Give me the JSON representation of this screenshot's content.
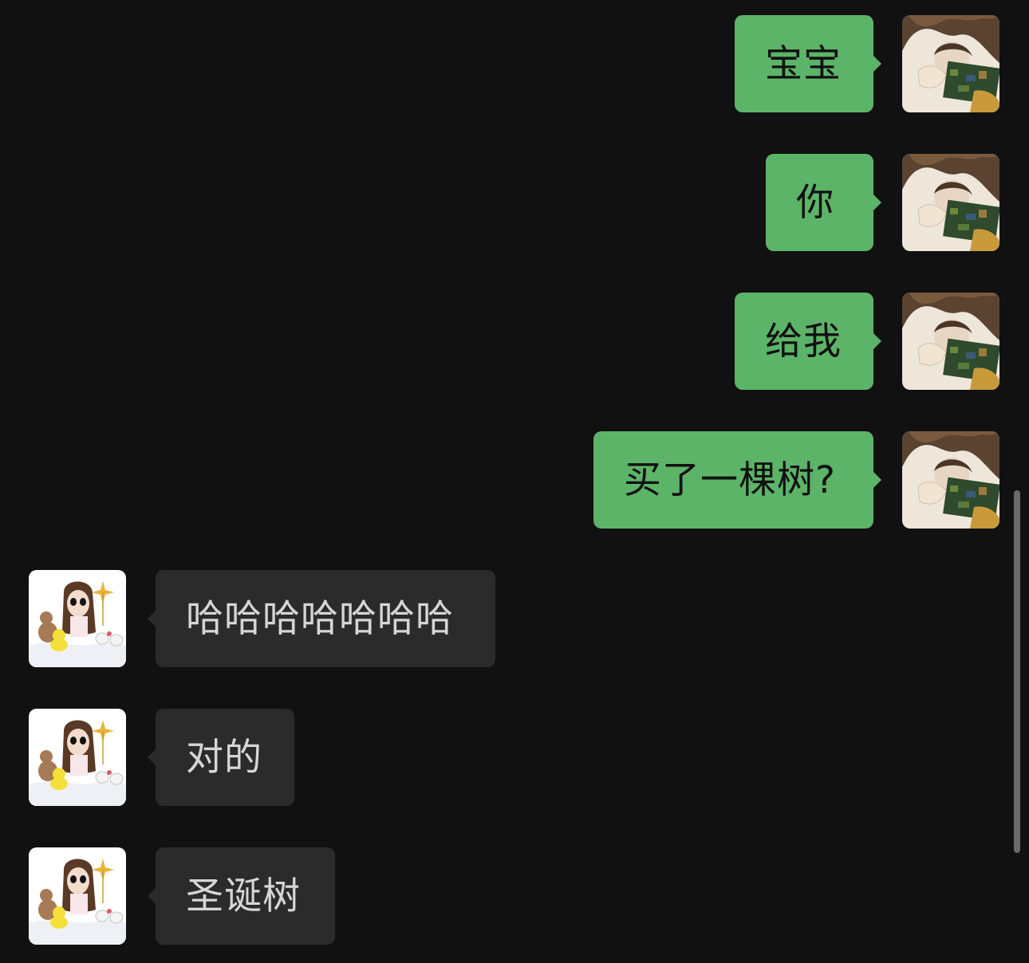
{
  "colors": {
    "background": "#111111",
    "sent_bubble": "#5cb468",
    "received_bubble": "#2b2b2b",
    "sent_text": "#111111",
    "received_text": "#d6d6d6",
    "scrollbar": "#6a6a6a"
  },
  "avatars": {
    "self": "avatar-self-illustration",
    "contact": "avatar-contact-illustration"
  },
  "messages": [
    {
      "side": "sent",
      "text": "宝宝"
    },
    {
      "side": "sent",
      "text": "你"
    },
    {
      "side": "sent",
      "text": "给我"
    },
    {
      "side": "sent",
      "text": "买了一棵树?"
    },
    {
      "side": "received",
      "text": "哈哈哈哈哈哈哈"
    },
    {
      "side": "received",
      "text": "对的"
    },
    {
      "side": "received",
      "text": "圣诞树"
    }
  ]
}
